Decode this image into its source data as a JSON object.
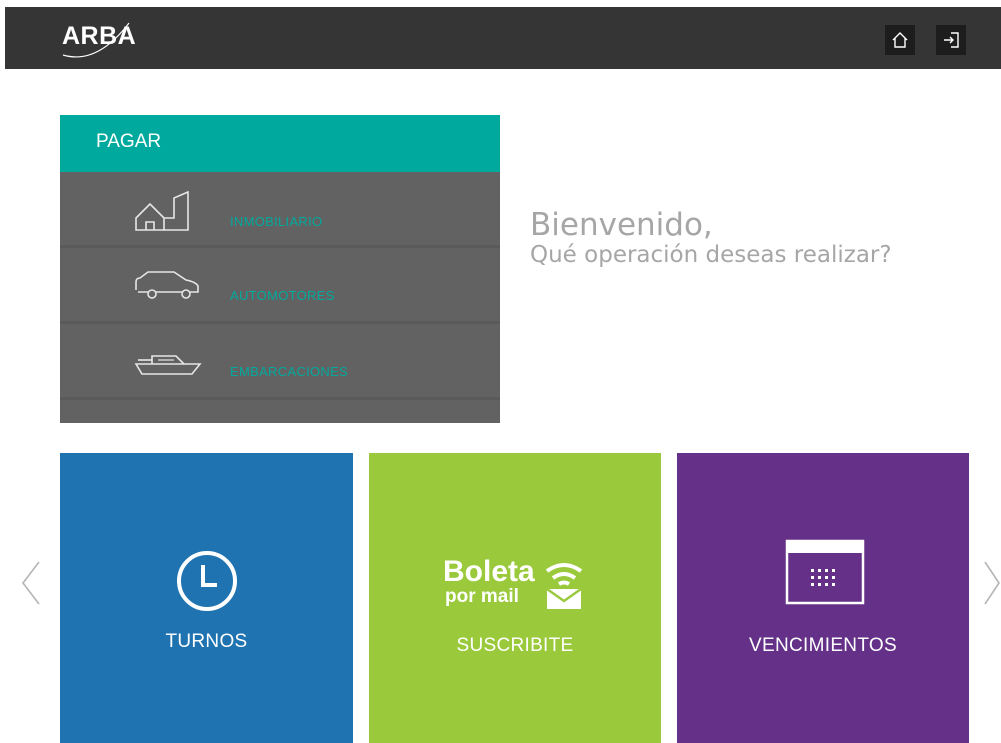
{
  "header": {
    "logo_text": "ARBA",
    "home_icon": "home-icon",
    "login_icon": "login-icon"
  },
  "pagar": {
    "title": "PAGAR",
    "items": [
      {
        "label": "INMOBILIARIO",
        "icon": "house-building-icon"
      },
      {
        "label": "AUTOMOTORES",
        "icon": "car-icon"
      },
      {
        "label": "EMBARCACIONES",
        "icon": "boat-icon"
      }
    ]
  },
  "welcome": {
    "title": "Bienvenido,",
    "subtitle": "Qué operación deseas realizar?"
  },
  "tiles": [
    {
      "label": "TURNOS",
      "icon": "clock-icon",
      "color": "#1e73b0"
    },
    {
      "label": "SUSCRIBITE",
      "logo_line1": "Boleta",
      "logo_line2": "por mail",
      "icon": "boleta-por-mail-logo",
      "color": "#9aca3c"
    },
    {
      "label": "VENCIMIENTOS",
      "icon": "calendar-icon",
      "color": "#653088"
    }
  ],
  "colors": {
    "topbar": "#353535",
    "accent": "#00a99d",
    "panel": "#626262"
  }
}
